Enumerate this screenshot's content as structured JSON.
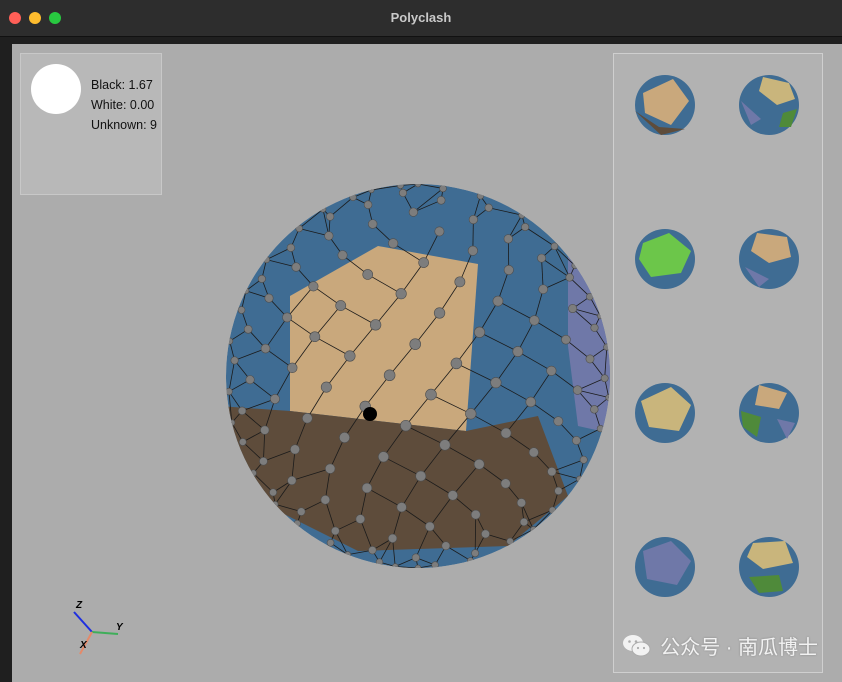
{
  "window": {
    "title": "Polyclash"
  },
  "score": {
    "black_label": "Black: 1.67",
    "white_label": "White: 0.00",
    "unknown_label": "Unknown: 9"
  },
  "current_player": "white",
  "axes": {
    "z": "Z",
    "y": "Y",
    "x": "X"
  },
  "watermark": {
    "text": "公众号 · 南瓜博士"
  },
  "colors": {
    "board_blue": "#3f6c93",
    "black_territory": "#5e4c3b",
    "white_territory": "#c9a87c",
    "unknown_region": "#6f78a8",
    "stone_gray": "#7d7d7d"
  }
}
